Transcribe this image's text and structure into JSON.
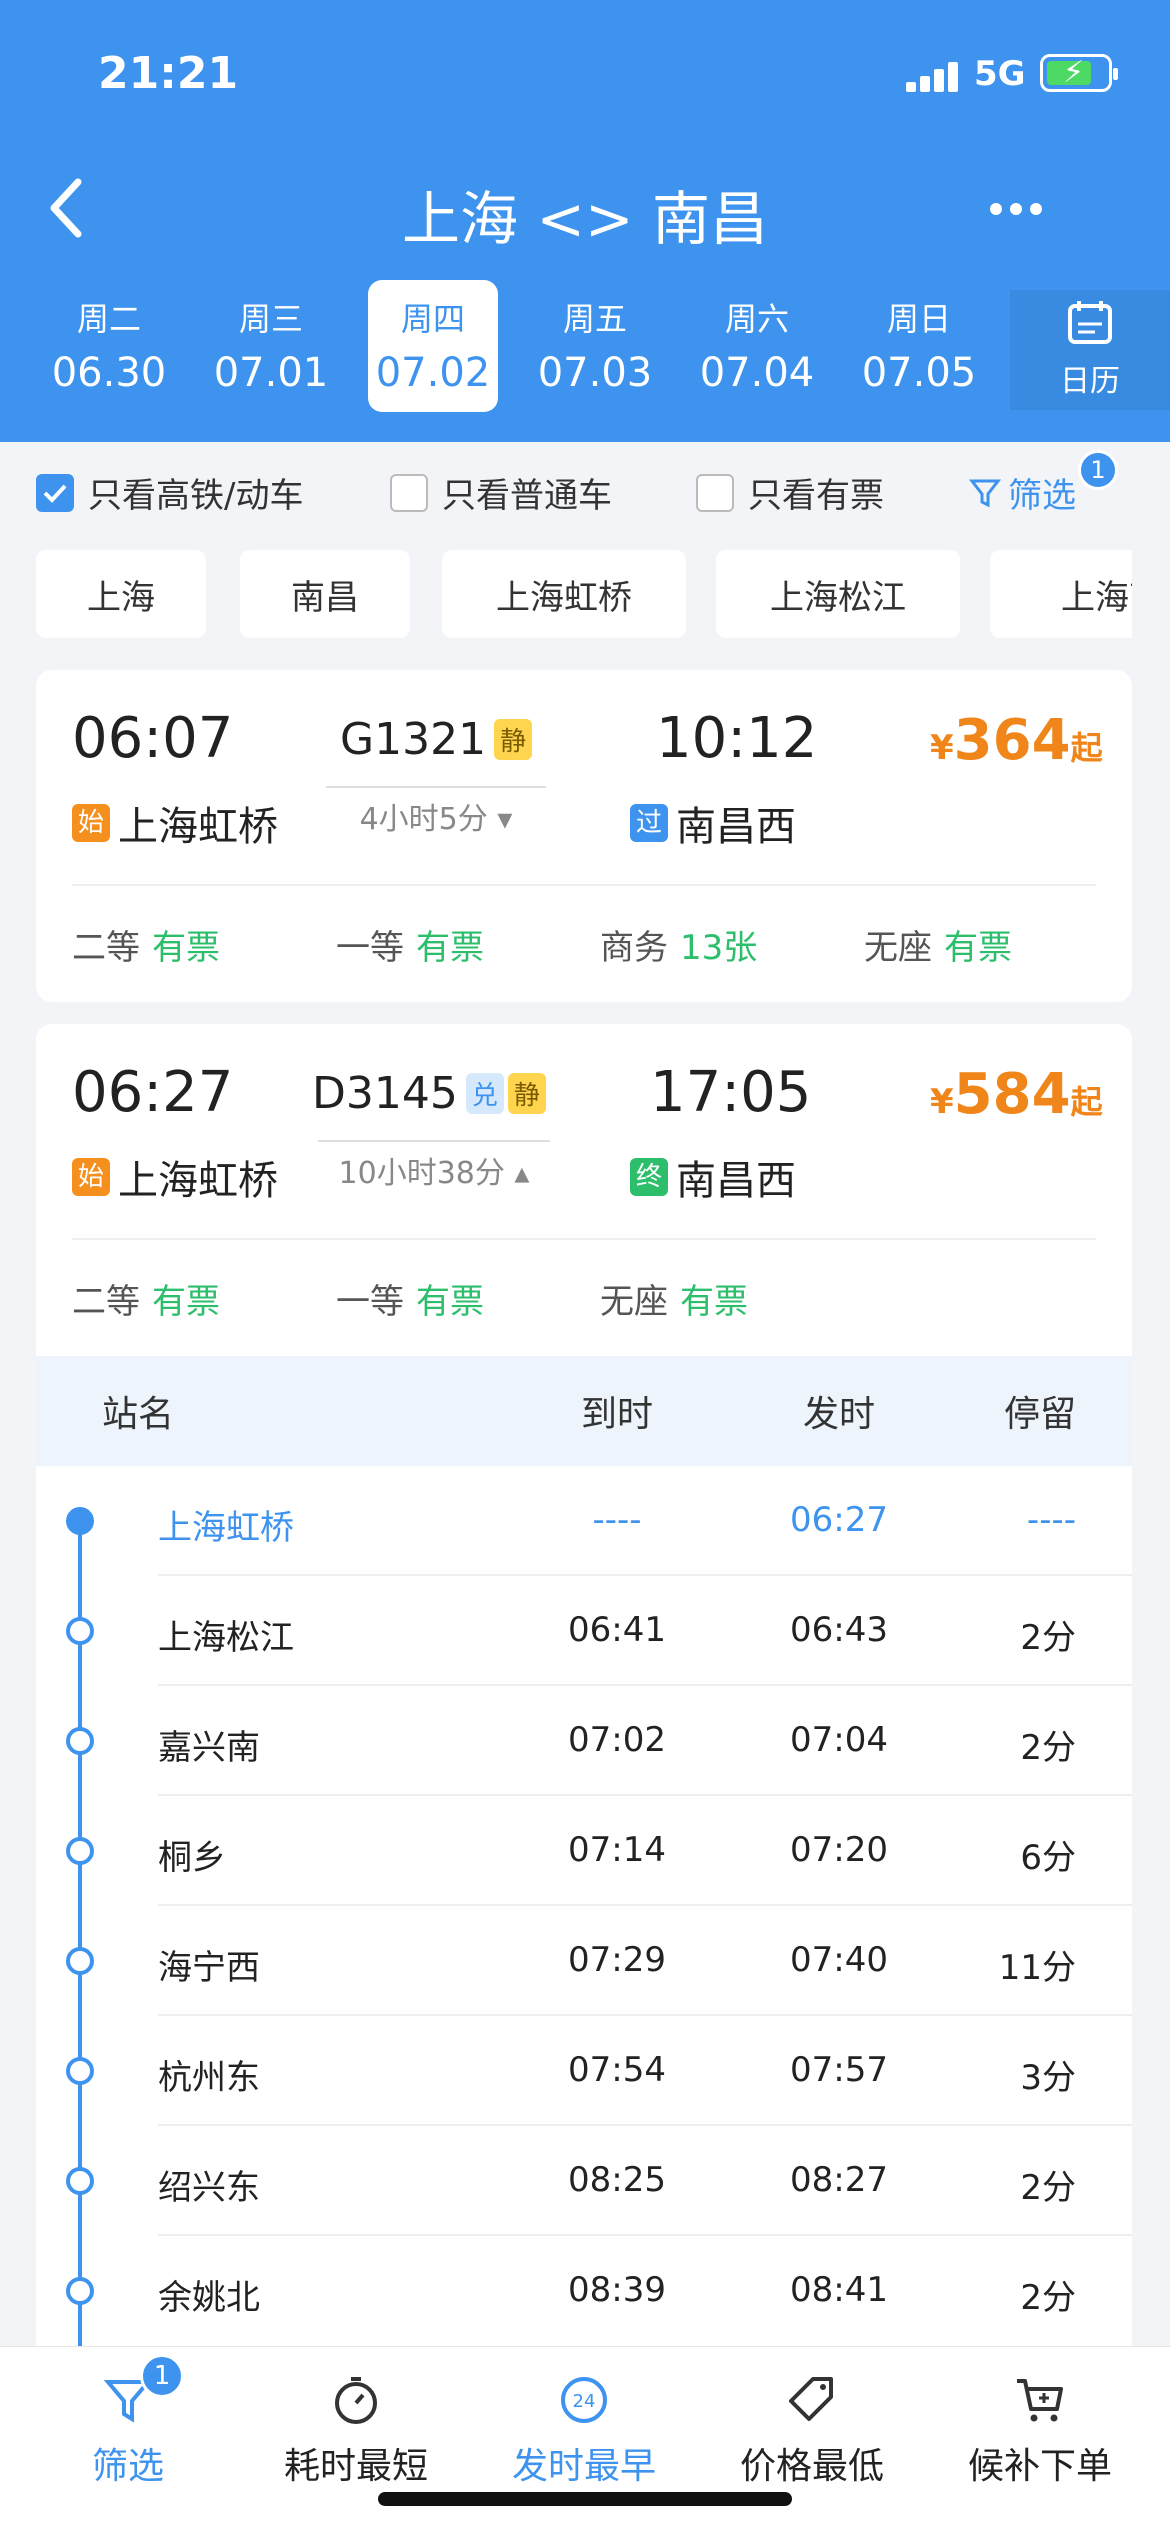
{
  "status": {
    "time": "21:21",
    "network": "5G"
  },
  "nav": {
    "title": "上海 <> 南昌"
  },
  "dates": [
    {
      "weekday": "周二",
      "date": "06.30"
    },
    {
      "weekday": "周三",
      "date": "07.01"
    },
    {
      "weekday": "周四",
      "date": "07.02",
      "active": true
    },
    {
      "weekday": "周五",
      "date": "07.03"
    },
    {
      "weekday": "周六",
      "date": "07.04"
    },
    {
      "weekday": "周日",
      "date": "07.05"
    }
  ],
  "calendar_label": "日历",
  "filters": {
    "high_speed": "只看高铁/动车",
    "normal": "只看普通车",
    "available": "只看有票",
    "filter_label": "筛选",
    "filter_count": "1"
  },
  "stations": [
    "上海",
    "南昌",
    "上海虹桥",
    "上海松江",
    "上海南"
  ],
  "trains": [
    {
      "dep_time": "06:07",
      "number": "G1321",
      "tags": [
        "静"
      ],
      "arr_time": "10:12",
      "duration": "4小时5分",
      "currency": "¥",
      "price": "364",
      "price_suffix": "起",
      "from_label": "始",
      "from": "上海虹桥",
      "to_label": "过",
      "to": "南昌西",
      "seats": [
        {
          "cls": "二等",
          "status": "有票"
        },
        {
          "cls": "一等",
          "status": "有票"
        },
        {
          "cls": "商务",
          "status": "13张"
        },
        {
          "cls": "无座",
          "status": "有票"
        }
      ]
    },
    {
      "dep_time": "06:27",
      "number": "D3145",
      "tags": [
        "兑",
        "静"
      ],
      "arr_time": "17:05",
      "duration": "10小时38分",
      "currency": "¥",
      "price": "584",
      "price_suffix": "起",
      "from_label": "始",
      "from": "上海虹桥",
      "to_label": "终",
      "to": "南昌西",
      "seats": [
        {
          "cls": "二等",
          "status": "有票"
        },
        {
          "cls": "一等",
          "status": "有票"
        },
        {
          "cls": "无座",
          "status": "有票"
        }
      ]
    }
  ],
  "stops_header": {
    "name": "站名",
    "arrive": "到时",
    "depart": "发时",
    "stay": "停留"
  },
  "stops": [
    {
      "name": "上海虹桥",
      "arrive": "----",
      "depart": "06:27",
      "stay": "----"
    },
    {
      "name": "上海松江",
      "arrive": "06:41",
      "depart": "06:43",
      "stay": "2分"
    },
    {
      "name": "嘉兴南",
      "arrive": "07:02",
      "depart": "07:04",
      "stay": "2分"
    },
    {
      "name": "桐乡",
      "arrive": "07:14",
      "depart": "07:20",
      "stay": "6分"
    },
    {
      "name": "海宁西",
      "arrive": "07:29",
      "depart": "07:40",
      "stay": "11分"
    },
    {
      "name": "杭州东",
      "arrive": "07:54",
      "depart": "07:57",
      "stay": "3分"
    },
    {
      "name": "绍兴东",
      "arrive": "08:25",
      "depart": "08:27",
      "stay": "2分"
    },
    {
      "name": "余姚北",
      "arrive": "08:39",
      "depart": "08:41",
      "stay": "2分"
    }
  ],
  "tabs": [
    {
      "label": "筛选",
      "icon": "filter-icon"
    },
    {
      "label": "耗时最短",
      "icon": "timer-icon"
    },
    {
      "label": "发时最早",
      "icon": "clock-24-icon"
    },
    {
      "label": "价格最低",
      "icon": "price-tag-icon"
    },
    {
      "label": "候补下单",
      "icon": "cart-icon"
    }
  ],
  "tab_badge": "1",
  "colors": {
    "primary": "#3D93EE",
    "price": "#F08519",
    "available": "#2DBE6C"
  }
}
